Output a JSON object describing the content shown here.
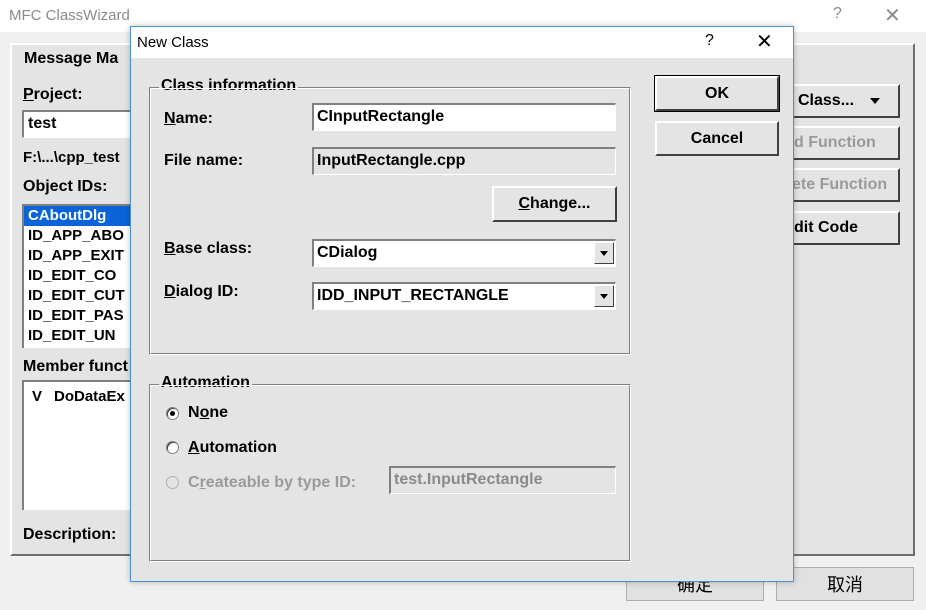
{
  "background_window": {
    "title": "MFC ClassWizard",
    "help_glyph": "?",
    "close_glyph": "✕",
    "tab_label": "Message Ma",
    "project_label": "Project:",
    "project_value": "test",
    "path_text": "F:\\...\\cpp_test",
    "object_ids_label": "Object IDs:",
    "object_ids": [
      "CAboutDlg",
      "ID_APP_ABO",
      "ID_APP_EXIT",
      "ID_EDIT_CO",
      "ID_EDIT_CUT",
      "ID_EDIT_PAS",
      "ID_EDIT_UN"
    ],
    "member_functions_label": "Member funct",
    "member_functions": [
      {
        "flag": "V",
        "name": "DoDataEx"
      }
    ],
    "description_label": "Description:",
    "buttons": {
      "add_class": "Class...",
      "add_function": "d Function",
      "delete_function": "ete Function",
      "edit_code": "dit Code"
    },
    "footer": {
      "ok": "确定",
      "cancel": "取消"
    }
  },
  "dialog": {
    "title": "New Class",
    "help_glyph": "?",
    "close_glyph": "✕",
    "ok_label": "OK",
    "cancel_label": "Cancel",
    "class_info": {
      "group_title": "Class information",
      "name_label": "Name:",
      "name_value": "CInputRectangle",
      "file_name_label": "File name:",
      "file_name_value": "InputRectangle.cpp",
      "change_button": "Change...",
      "base_class_label": "Base class:",
      "base_class_value": "CDialog",
      "dialog_id_label": "Dialog ID:",
      "dialog_id_value": "IDD_INPUT_RECTANGLE"
    },
    "automation": {
      "group_title": "Automation",
      "options": [
        {
          "label": "None",
          "checked": true,
          "enabled": true
        },
        {
          "label": "Automation",
          "checked": false,
          "enabled": true
        },
        {
          "label": "Createable by type ID:",
          "checked": false,
          "enabled": false
        }
      ],
      "type_id_value": "test.InputRectangle"
    }
  }
}
